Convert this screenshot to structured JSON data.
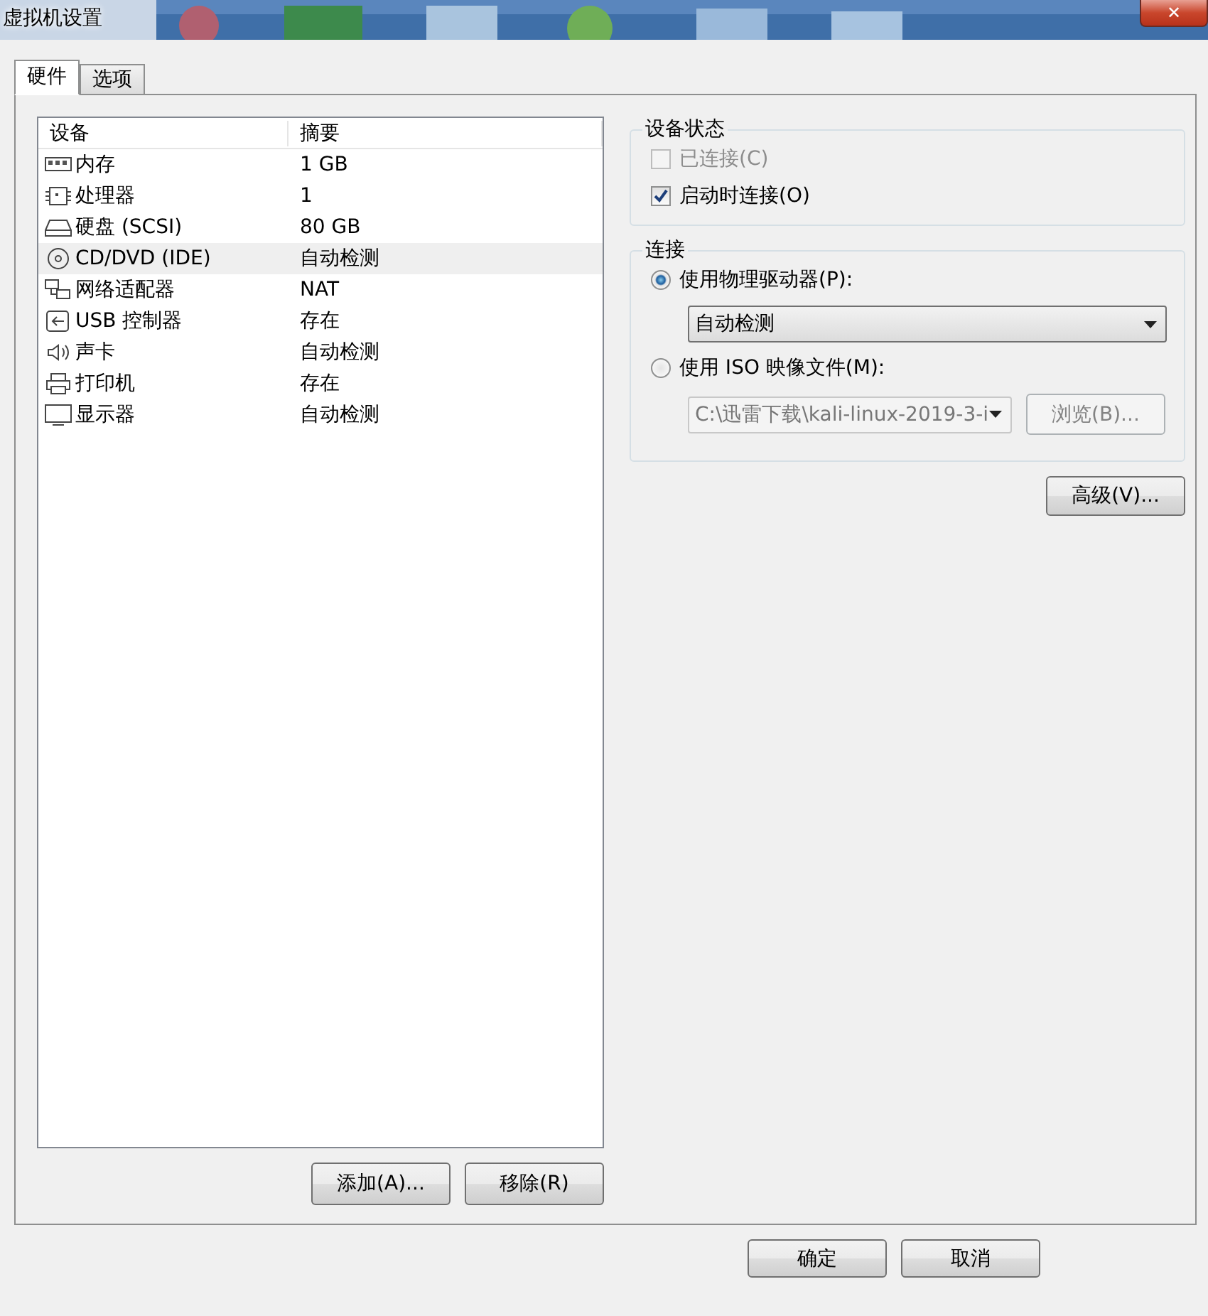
{
  "window": {
    "title": "虚拟机设置",
    "close": "✕"
  },
  "tabs": [
    {
      "label": "硬件",
      "selected": true
    },
    {
      "label": "选项",
      "selected": false
    }
  ],
  "devices": {
    "columns": [
      "设备",
      "摘要"
    ],
    "rows": [
      {
        "kind": "memory",
        "name": "内存",
        "summary": "1 GB",
        "selected": false
      },
      {
        "kind": "cpu",
        "name": "处理器",
        "summary": "1",
        "selected": false
      },
      {
        "kind": "disk",
        "name": "硬盘 (SCSI)",
        "summary": "80 GB",
        "selected": false
      },
      {
        "kind": "cd",
        "name": "CD/DVD (IDE)",
        "summary": "自动检测",
        "selected": true
      },
      {
        "kind": "network",
        "name": "网络适配器",
        "summary": "NAT",
        "selected": false
      },
      {
        "kind": "usb",
        "name": "USB 控制器",
        "summary": "存在",
        "selected": false
      },
      {
        "kind": "sound",
        "name": "声卡",
        "summary": "自动检测",
        "selected": false
      },
      {
        "kind": "printer",
        "name": "打印机",
        "summary": "存在",
        "selected": false
      },
      {
        "kind": "display",
        "name": "显示器",
        "summary": "自动检测",
        "selected": false
      }
    ]
  },
  "list_buttons": [
    "添加(A)...",
    "移除(R)"
  ],
  "device_status": {
    "title": "设备状态",
    "options": [
      {
        "label": "已连接(C)",
        "checked": false,
        "disabled": true
      },
      {
        "label": "启动时连接(O)",
        "checked": true,
        "disabled": false
      }
    ]
  },
  "connection": {
    "title": "连接",
    "physical": {
      "label": "使用物理驱动器(P):",
      "selected": true,
      "value": "自动检测"
    },
    "iso": {
      "label": "使用 ISO 映像文件(M):",
      "selected": false,
      "value": "C:\\迅雷下载\\kali-linux-2019-3-i",
      "browse": "浏览(B)..."
    }
  },
  "advanced": "高级(V)...",
  "footer": [
    "确定",
    "取消"
  ]
}
